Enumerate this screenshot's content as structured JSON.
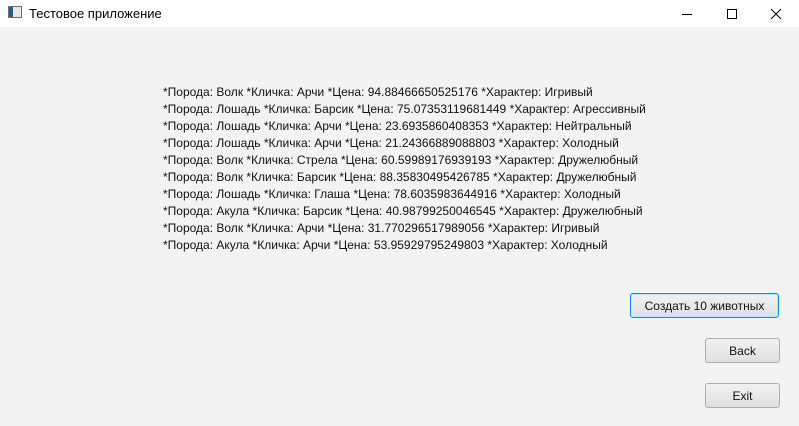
{
  "window": {
    "title": "Тестовое приложение",
    "icon": "app-window-icon",
    "controls": [
      "minimize-icon",
      "maximize-icon",
      "close-icon"
    ]
  },
  "animals": [
    "*Порода: Волк *Кличка: Арчи *Цена: 94.88466650525176 *Характер: Игривый",
    "*Порода: Лошадь *Кличка: Барсик *Цена: 75.07353119681449 *Характер: Агрессивный",
    "*Порода: Лошадь *Кличка: Арчи *Цена: 23.6935860408353 *Характер: Нейтральный",
    "*Порода: Лошадь *Кличка: Арчи *Цена: 21.24366889088803 *Характер: Холодный",
    "*Порода: Волк *Кличка: Стрела *Цена: 60.59989176939193 *Характер: Дружелюбный",
    "*Порода: Волк *Кличка: Барсик *Цена: 88.35830495426785 *Характер: Дружелюбный",
    "*Порода: Лошадь *Кличка: Глаша *Цена: 78.6035983644916 *Характер: Холодный",
    "*Порода: Акула *Кличка: Барсик *Цена: 40.98799250046545 *Характер: Дружелюбный",
    "*Порода: Волк *Кличка: Арчи *Цена: 31.770296517989056 *Характер: Игривый",
    "*Порода: Акула *Кличка: Арчи *Цена: 53.95929795249803 *Характер: Холодный"
  ],
  "buttons": {
    "create": "Создать 10 животных",
    "back": "Back",
    "exit": "Exit"
  },
  "colors": {
    "background": "#f3f3f3",
    "focus_border": "#0a8ed6"
  }
}
